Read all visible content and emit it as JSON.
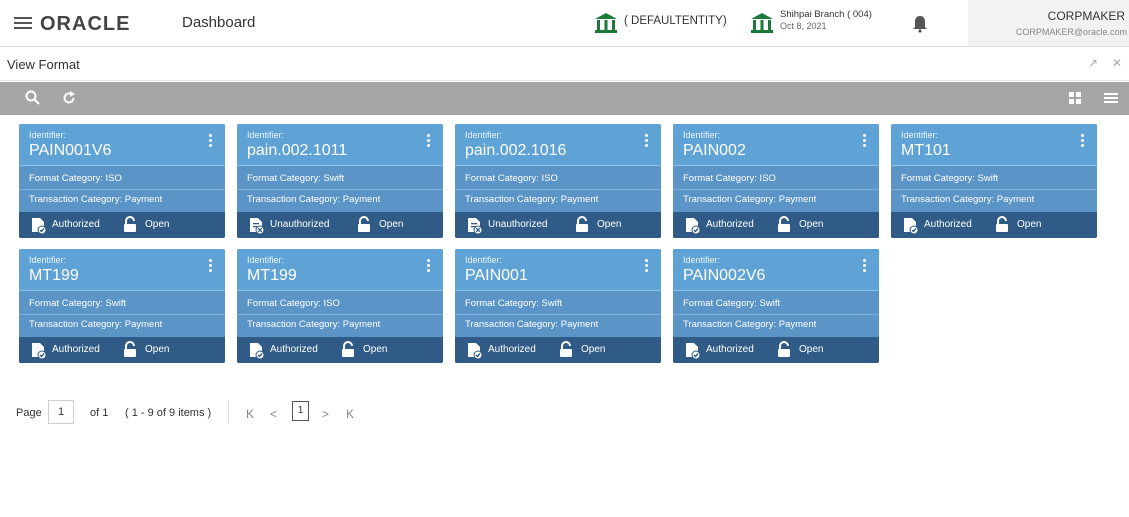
{
  "header": {
    "app_title": "Dashboard",
    "logo_text": "ORACLE",
    "entity": "( DEFAULTENTITY)",
    "branch_name": "Shihpai Branch  ( 004)",
    "branch_date": "Oct 8, 2021",
    "user_name": "CORPMAKER",
    "user_email": "CORPMAKER@oracle.com"
  },
  "page": {
    "title": "View Format"
  },
  "toolbar": {
    "icons": [
      "search-icon",
      "refresh-icon",
      "grid-view-icon",
      "list-view-icon"
    ]
  },
  "labels": {
    "identifier": "Identifier:",
    "format_prefix": "Format Category: ",
    "transaction_prefix": "Transaction Category: ",
    "open": "Open"
  },
  "cards": [
    {
      "identifier": "PAIN001V6",
      "format_category": "Format Category: ISO",
      "transaction_category": "Transaction Category: Payment",
      "status": "Authorized"
    },
    {
      "identifier": "pain.002.1011",
      "format_category": "Format Category: Swift",
      "transaction_category": "Transaction Category: Payment",
      "status": "Unauthorized"
    },
    {
      "identifier": "pain.002.1016",
      "format_category": "Format Category: ISO",
      "transaction_category": "Transaction Category: Payment",
      "status": "Unauthorized"
    },
    {
      "identifier": "PAIN002",
      "format_category": "Format Category: ISO",
      "transaction_category": "Transaction Category: Payment",
      "status": "Authorized"
    },
    {
      "identifier": "MT101",
      "format_category": "Format Category: Swift",
      "transaction_category": "Transaction Category: Payment",
      "status": "Authorized"
    },
    {
      "identifier": "MT199",
      "format_category": "Format Category: Swift",
      "transaction_category": "Transaction Category: Payment",
      "status": "Authorized"
    },
    {
      "identifier": "MT199",
      "format_category": "Format Category: ISO",
      "transaction_category": "Transaction Category: Payment",
      "status": "Authorized"
    },
    {
      "identifier": "PAIN001",
      "format_category": "Format Category: Swift",
      "transaction_category": "Transaction Category: Payment",
      "status": "Authorized"
    },
    {
      "identifier": "PAIN002V6",
      "format_category": "Format Category: Swift",
      "transaction_category": "Transaction Category: Payment",
      "status": "Authorized"
    }
  ],
  "pagination": {
    "page_label": "Page",
    "page_value": "1",
    "of_label": "of 1",
    "items_label": "( 1 - 9 of 9 items )",
    "current_page": "1",
    "first_symbol": "K",
    "prev_symbol": "<",
    "next_symbol": ">",
    "last_symbol": "K"
  },
  "colors": {
    "card_head": "#5fa3d6",
    "card_body": "#5b94c7",
    "card_footer": "#2f5b86",
    "toolbar": "#a6a6a6",
    "bank_green": "#1b7a3a"
  }
}
